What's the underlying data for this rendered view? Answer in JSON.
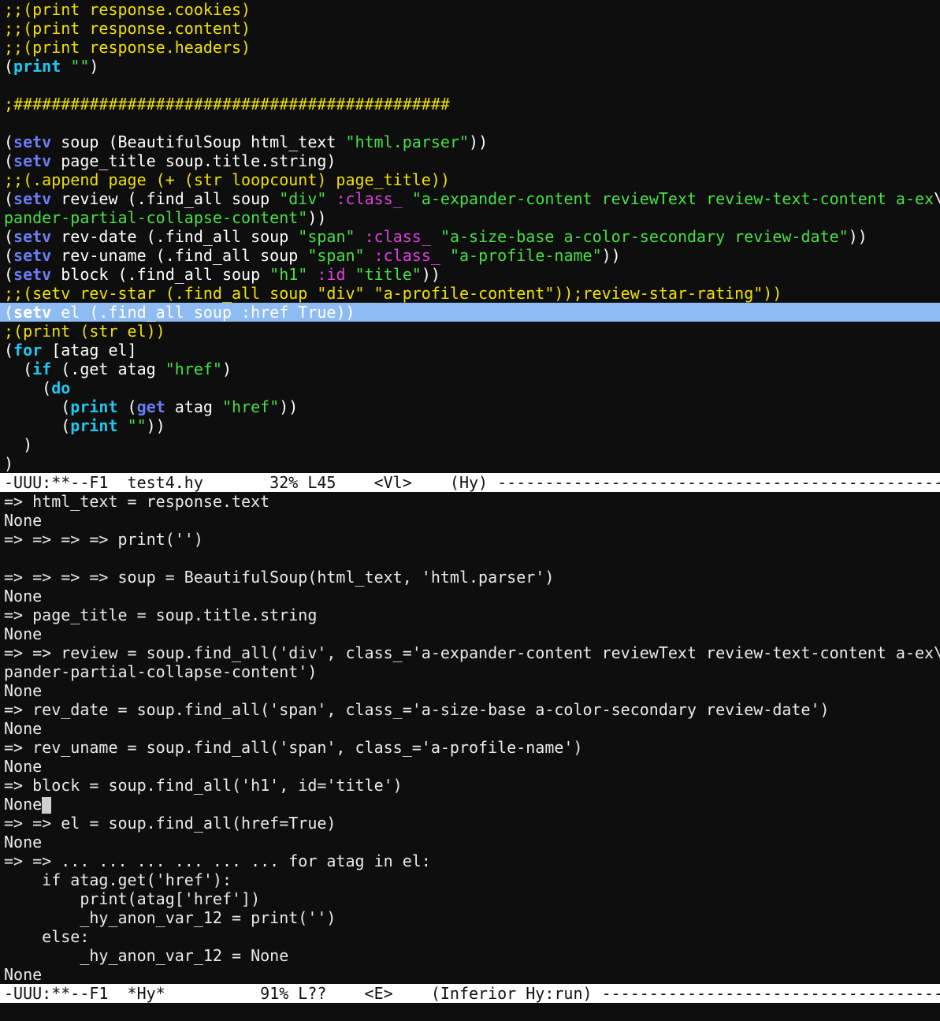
{
  "colors": {
    "background": "#0e0e0e",
    "comment": "#f0e000",
    "special_form": "#20c8f0",
    "builtin": "#6c7cf5",
    "string": "#46e046",
    "keyword": "#e040e0",
    "highlight": "#8fbbf3",
    "modeline_bg": "#ffffff"
  },
  "editor": {
    "buffer": "test4.hy",
    "lines": [
      [
        [
          "c",
          ";;(print response.cookies)"
        ]
      ],
      [
        [
          "c",
          ";;(print response.content)"
        ]
      ],
      [
        [
          "c",
          ";;(print response.headers)"
        ]
      ],
      [
        [
          "t",
          "("
        ],
        [
          "k",
          "print"
        ],
        [
          "t",
          " "
        ],
        [
          "s",
          "\"\""
        ],
        [
          "t",
          ")"
        ]
      ],
      [
        [
          "t",
          ""
        ]
      ],
      [
        [
          "c",
          ";##############################################"
        ]
      ],
      [
        [
          "t",
          ""
        ]
      ],
      [
        [
          "t",
          "("
        ],
        [
          "f",
          "setv"
        ],
        [
          "t",
          " soup (BeautifulSoup html_text "
        ],
        [
          "s",
          "\"html.parser\""
        ],
        [
          "t",
          "))"
        ]
      ],
      [
        [
          "t",
          "("
        ],
        [
          "f",
          "setv"
        ],
        [
          "t",
          " page_title soup.title.string)"
        ]
      ],
      [
        [
          "c",
          ";;(.append page (+ (str loopcount) page_title))"
        ]
      ],
      [
        [
          "t",
          "("
        ],
        [
          "f",
          "setv"
        ],
        [
          "t",
          " review (.find_all soup "
        ],
        [
          "s",
          "\"div\""
        ],
        [
          "t",
          " "
        ],
        [
          "kw",
          ":class_"
        ],
        [
          "t",
          " "
        ],
        [
          "s",
          "\"a-expander-content reviewText review-text-content a-ex"
        ],
        [
          "t",
          "\\"
        ]
      ],
      [
        [
          "s",
          "pander-partial-collapse-content\""
        ],
        [
          "t",
          "))"
        ]
      ],
      [
        [
          "t",
          "("
        ],
        [
          "f",
          "setv"
        ],
        [
          "t",
          " rev-date (.find_all soup "
        ],
        [
          "s",
          "\"span\""
        ],
        [
          "t",
          " "
        ],
        [
          "kw",
          ":class_"
        ],
        [
          "t",
          " "
        ],
        [
          "s",
          "\"a-size-base a-color-secondary review-date\""
        ],
        [
          "t",
          "))"
        ]
      ],
      [
        [
          "t",
          "("
        ],
        [
          "f",
          "setv"
        ],
        [
          "t",
          " rev-uname (.find_all soup "
        ],
        [
          "s",
          "\"span\""
        ],
        [
          "t",
          " "
        ],
        [
          "kw",
          ":class_"
        ],
        [
          "t",
          " "
        ],
        [
          "s",
          "\"a-profile-name\""
        ],
        [
          "t",
          "))"
        ]
      ],
      [
        [
          "t",
          "("
        ],
        [
          "f",
          "setv"
        ],
        [
          "t",
          " block (.find_all soup "
        ],
        [
          "s",
          "\"h1\""
        ],
        [
          "t",
          " "
        ],
        [
          "kw",
          ":id"
        ],
        [
          "t",
          " "
        ],
        [
          "s",
          "\"title\""
        ],
        [
          "t",
          "))"
        ]
      ],
      [
        [
          "c",
          ";;(setv rev-star (.find_all soup \"div\" \"a-profile-content\"));review-star-rating\"))"
        ]
      ],
      [
        [
          "t",
          "("
        ],
        [
          "k",
          "setv"
        ],
        [
          "t",
          " el (.find_all soup :href True))"
        ]
      ],
      [
        [
          "c",
          ";(print (str el))"
        ]
      ],
      [
        [
          "t",
          "("
        ],
        [
          "k",
          "for"
        ],
        [
          "t",
          " [atag el]"
        ]
      ],
      [
        [
          "t",
          "  ("
        ],
        [
          "k",
          "if"
        ],
        [
          "t",
          " (.get atag "
        ],
        [
          "s",
          "\"href\""
        ],
        [
          "t",
          ")"
        ]
      ],
      [
        [
          "t",
          "    ("
        ],
        [
          "k",
          "do"
        ]
      ],
      [
        [
          "t",
          "      ("
        ],
        [
          "k",
          "print"
        ],
        [
          "t",
          " ("
        ],
        [
          "f",
          "get"
        ],
        [
          "t",
          " atag "
        ],
        [
          "s",
          "\"href\""
        ],
        [
          "t",
          "))"
        ]
      ],
      [
        [
          "t",
          "      ("
        ],
        [
          "k",
          "print"
        ],
        [
          "t",
          " "
        ],
        [
          "s",
          "\"\""
        ],
        [
          "t",
          "))"
        ]
      ],
      [
        [
          "t",
          "  )"
        ]
      ],
      [
        [
          "t",
          ")"
        ]
      ]
    ],
    "highlighted_line": 16,
    "modeline": "-UUU:**--F1  test4.hy       32% L45    <Vl>    (Hy) ------------------------------------------------------------------"
  },
  "repl": {
    "lines": [
      "=> html_text = response.text",
      "None",
      "=> => => => print('')",
      "",
      "=> => => => soup = BeautifulSoup(html_text, 'html.parser')",
      "None",
      "=> page_title = soup.title.string",
      "None",
      "=> => review = soup.find_all('div', class_='a-expander-content reviewText review-text-content a-ex\\",
      "pander-partial-collapse-content')",
      "None",
      "=> rev_date = soup.find_all('span', class_='a-size-base a-color-secondary review-date')",
      "None",
      "=> rev_uname = soup.find_all('span', class_='a-profile-name')",
      "None",
      "=> block = soup.find_all('h1', id='title')",
      "None",
      "=> => el = soup.find_all(href=True)",
      "None",
      "=> => ... ... ... ... ... ... for atag in el:",
      "    if atag.get('href'):",
      "        print(atag['href'])",
      "        _hy_anon_var_12 = print('')",
      "    else:",
      "        _hy_anon_var_12 = None",
      "None"
    ],
    "cursor_line": 16,
    "modeline": "-UUU:**--F1  *Hy*          91% L??    <E>    (Inferior Hy:run) ------------------------------------------------------------"
  }
}
